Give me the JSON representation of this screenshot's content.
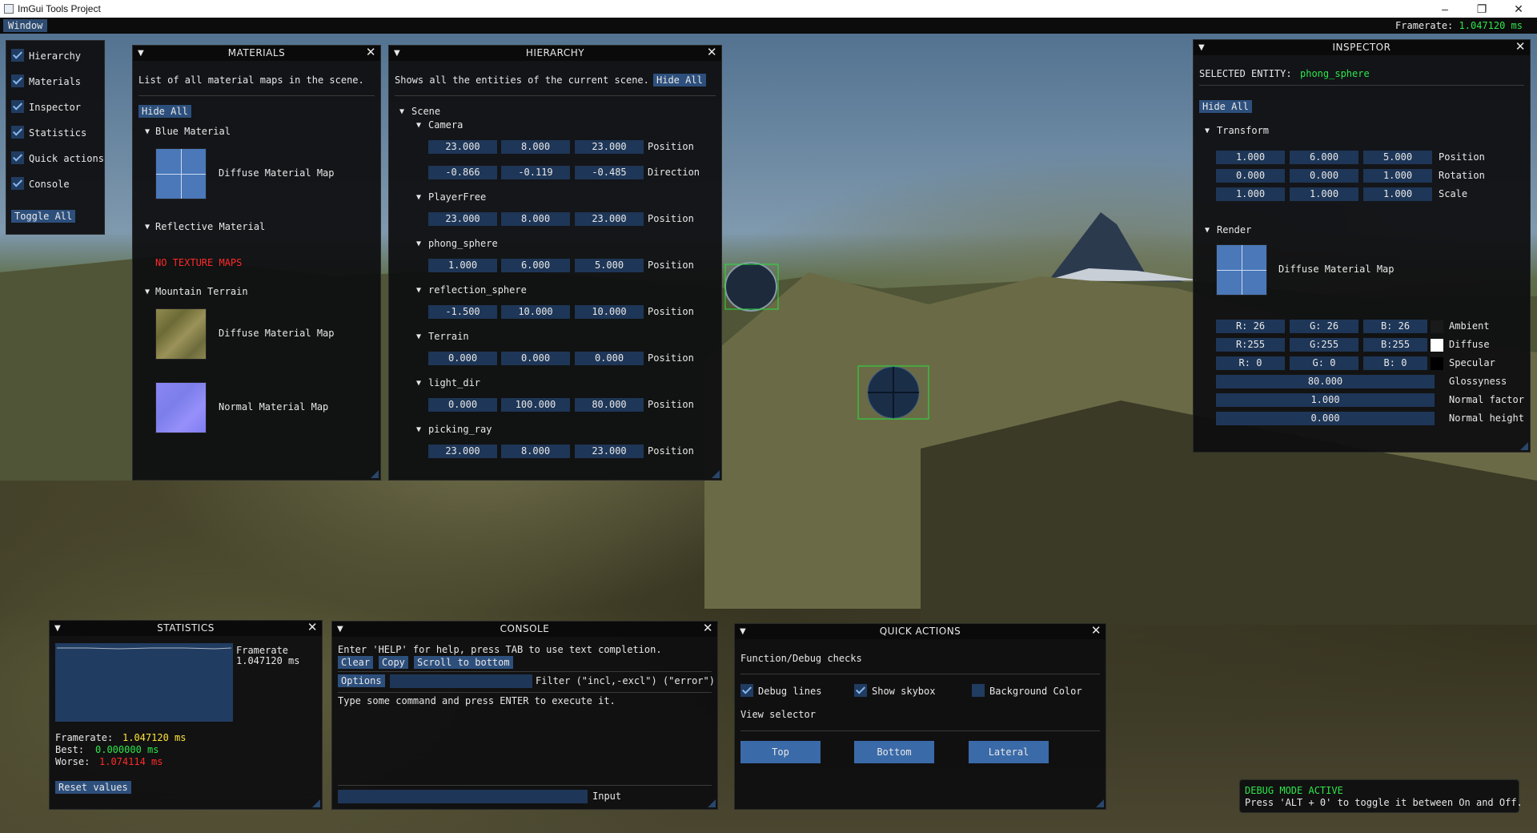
{
  "app": {
    "title": "ImGui Tools Project"
  },
  "menubar": {
    "window_label": "Window",
    "framerate_label": "Framerate:",
    "framerate_value": "1.047120 ms"
  },
  "sidebar": {
    "items": [
      {
        "label": "Hierarchy",
        "checked": true
      },
      {
        "label": "Materials",
        "checked": true
      },
      {
        "label": "Inspector",
        "checked": true
      },
      {
        "label": "Statistics",
        "checked": true
      },
      {
        "label": "Quick actions",
        "checked": true
      },
      {
        "label": "Console",
        "checked": true
      }
    ],
    "toggle_all": "Toggle All"
  },
  "materials": {
    "title": "MATERIALS",
    "description": "List of all material maps in the scene.",
    "hide_all": "Hide All",
    "blue_material": "Blue Material",
    "blue_diffuse": "Diffuse Material Map",
    "reflective_material": "Reflective Material",
    "no_texture": "NO TEXTURE MAPS",
    "mountain_terrain": "Mountain Terrain",
    "terrain_diffuse": "Diffuse Material Map",
    "terrain_normal": "Normal Material Map"
  },
  "hierarchy": {
    "title": "HIERARCHY",
    "description": "Shows all the entities of the current scene.",
    "hide_all": "Hide All",
    "scene": "Scene",
    "entities": [
      {
        "name": "Camera",
        "rows": [
          {
            "v": [
              "23.000",
              "8.000",
              "23.000"
            ],
            "label": "Position"
          },
          {
            "v": [
              "-0.866",
              "-0.119",
              "-0.485"
            ],
            "label": "Direction"
          }
        ]
      },
      {
        "name": "PlayerFree",
        "rows": [
          {
            "v": [
              "23.000",
              "8.000",
              "23.000"
            ],
            "label": "Position"
          }
        ]
      },
      {
        "name": "phong_sphere",
        "rows": [
          {
            "v": [
              "1.000",
              "6.000",
              "5.000"
            ],
            "label": "Position"
          }
        ]
      },
      {
        "name": "reflection_sphere",
        "rows": [
          {
            "v": [
              "-1.500",
              "10.000",
              "10.000"
            ],
            "label": "Position"
          }
        ]
      },
      {
        "name": "Terrain",
        "rows": [
          {
            "v": [
              "0.000",
              "0.000",
              "0.000"
            ],
            "label": "Position"
          }
        ]
      },
      {
        "name": "light_dir",
        "rows": [
          {
            "v": [
              "0.000",
              "100.000",
              "80.000"
            ],
            "label": "Position"
          }
        ]
      },
      {
        "name": "picking_ray",
        "rows": [
          {
            "v": [
              "23.000",
              "8.000",
              "23.000"
            ],
            "label": "Position"
          }
        ]
      }
    ]
  },
  "inspector": {
    "title": "INSPECTOR",
    "selected_label": "SELECTED ENTITY:",
    "selected_value": "phong_sphere",
    "hide_all": "Hide All",
    "transform": "Transform",
    "transform_rows": [
      {
        "v": [
          "1.000",
          "6.000",
          "5.000"
        ],
        "label": "Position"
      },
      {
        "v": [
          "0.000",
          "0.000",
          "1.000"
        ],
        "label": "Rotation"
      },
      {
        "v": [
          "1.000",
          "1.000",
          "1.000"
        ],
        "label": "Scale"
      }
    ],
    "render": "Render",
    "diffuse_map": "Diffuse Material Map",
    "color_rows": [
      {
        "v": [
          "R: 26",
          "G: 26",
          "B: 26"
        ],
        "label": "Ambient",
        "color": "#1a1a1a"
      },
      {
        "v": [
          "R:255",
          "G:255",
          "B:255"
        ],
        "label": "Diffuse",
        "color": "#ffffff"
      },
      {
        "v": [
          "R:  0",
          "G:  0",
          "B:  0"
        ],
        "label": "Specular",
        "color": "#000000"
      }
    ],
    "scalar_rows": [
      {
        "v": "80.000",
        "label": "Glossyness"
      },
      {
        "v": "1.000",
        "label": "Normal factor"
      },
      {
        "v": "0.000",
        "label": "Normal height"
      }
    ]
  },
  "statistics": {
    "title": "STATISTICS",
    "plot_label": "Framerate",
    "plot_value": "1.047120 ms",
    "framerate_label": "Framerate:",
    "framerate_value": "1.047120 ms",
    "best_label": "Best:",
    "best_value": "0.000000 ms",
    "worse_label": "Worse:",
    "worse_value": "1.074114 ms",
    "reset": "Reset values"
  },
  "console": {
    "title": "CONSOLE",
    "help": "Enter 'HELP' for help, press TAB to use text completion.",
    "clear": "Clear",
    "copy": "Copy",
    "scroll_bottom": "Scroll to bottom",
    "options": "Options",
    "filter_label": "Filter (\"incl,-excl\") (\"error\")",
    "log_line": "Type some command and press ENTER to execute it.",
    "input_label": "Input"
  },
  "quick_actions": {
    "title": "QUICK ACTIONS",
    "section_debug": "Function/Debug checks",
    "checks": [
      {
        "label": "Debug lines",
        "checked": true
      },
      {
        "label": "Show skybox",
        "checked": true
      },
      {
        "label": "Background Color",
        "checked": false
      }
    ],
    "view_selector": "View selector",
    "views": [
      "Top",
      "Bottom",
      "Lateral"
    ]
  },
  "debug_overlay": {
    "line1": "DEBUG MODE ACTIVE",
    "line2": "Press 'ALT + 0' to toggle it between On and Off."
  }
}
